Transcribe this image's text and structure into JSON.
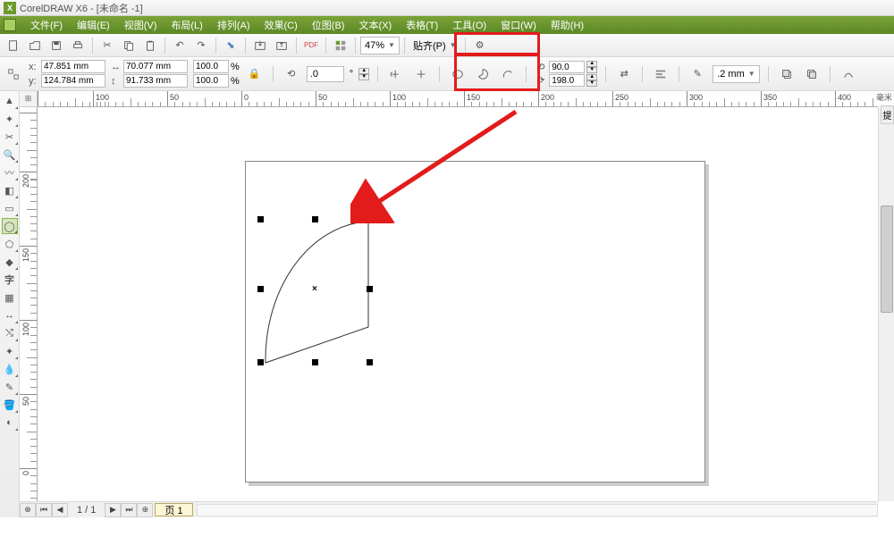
{
  "title": "CorelDRAW X6 - [未命名 -1]",
  "menu": [
    "文件(F)",
    "编辑(E)",
    "视图(V)",
    "布局(L)",
    "排列(A)",
    "效果(C)",
    "位图(B)",
    "文本(X)",
    "表格(T)",
    "工具(O)",
    "窗口(W)",
    "帮助(H)"
  ],
  "stdToolbar": {
    "zoom": "47%",
    "snapDropdown": "贴齐(P)"
  },
  "props": {
    "x_label": "x:",
    "y_label": "y:",
    "x": "47.851 mm",
    "y": "124.784 mm",
    "w": "70.077 mm",
    "h": "91.733 mm",
    "scale_x": "100.0",
    "scale_y": "100.0",
    "scale_unit": "%",
    "rotate": ".0",
    "rotate_unit": "°",
    "startAngle": "90.0",
    "endAngle": "198.0",
    "stroke": ".2 mm"
  },
  "ruler_h": [
    {
      "pos": 0,
      "label": ""
    },
    {
      "pos": 62,
      "label": "100"
    },
    {
      "pos": 145,
      "label": "50"
    },
    {
      "pos": 228,
      "label": "0"
    },
    {
      "pos": 311,
      "label": "50"
    },
    {
      "pos": 394,
      "label": "100"
    },
    {
      "pos": 477,
      "label": "150"
    },
    {
      "pos": 560,
      "label": "200"
    },
    {
      "pos": 643,
      "label": "250"
    },
    {
      "pos": 726,
      "label": "300"
    },
    {
      "pos": 809,
      "label": "350"
    },
    {
      "pos": 892,
      "label": "400"
    }
  ],
  "ruler_v": [
    {
      "pos": 6,
      "label": ""
    },
    {
      "pos": 72,
      "label": "200"
    },
    {
      "pos": 155,
      "label": "150"
    },
    {
      "pos": 238,
      "label": "100"
    },
    {
      "pos": 321,
      "label": "50"
    },
    {
      "pos": 404,
      "label": "0"
    }
  ],
  "page_nav": {
    "indicator": "1 / 1",
    "pageTab": "页 1"
  },
  "rightPanel": {
    "label1": "提"
  }
}
